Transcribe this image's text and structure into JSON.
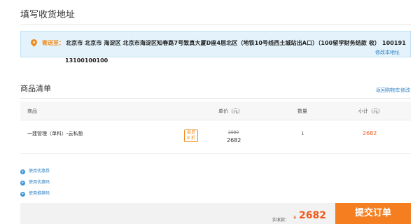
{
  "address_section": {
    "title": "填写收货地址",
    "ship_to_label": "寄送至：",
    "address": "北京市 北京市 海淀区 北京市海淀区知春路7号致真大厦D座4层北区（地铁10号线西土城站出A口）（100留学财务结款 收） 100191",
    "phone": "13100100100",
    "edit_link": "修改本地址"
  },
  "goods_section": {
    "title": "商品清单",
    "back_link": "返回购物车修改",
    "headers": {
      "product": "商品",
      "unit_price": "单价（元）",
      "quantity": "数量",
      "subtotal": "小计（元）"
    },
    "items": [
      {
        "name": "一建管理（单科）-云私塾",
        "badge_line1": "会员",
        "badge_line2": "9 折",
        "original_price": "2980",
        "price": "2682",
        "quantity": "1",
        "subtotal": "2682"
      }
    ]
  },
  "options": {
    "coupon_voucher": "使用优惠券",
    "coupon_code": "使用优惠码",
    "referral_code": "使用推荐码"
  },
  "footer": {
    "pay_label": "实收款：",
    "currency": "¥",
    "amount": "2682",
    "submit_label": "提交订单"
  },
  "colors": {
    "accent_orange": "#f57e20",
    "price_red": "#f05a1c",
    "link_blue": "#2f7fc1",
    "address_bg": "#e4f3fb"
  }
}
